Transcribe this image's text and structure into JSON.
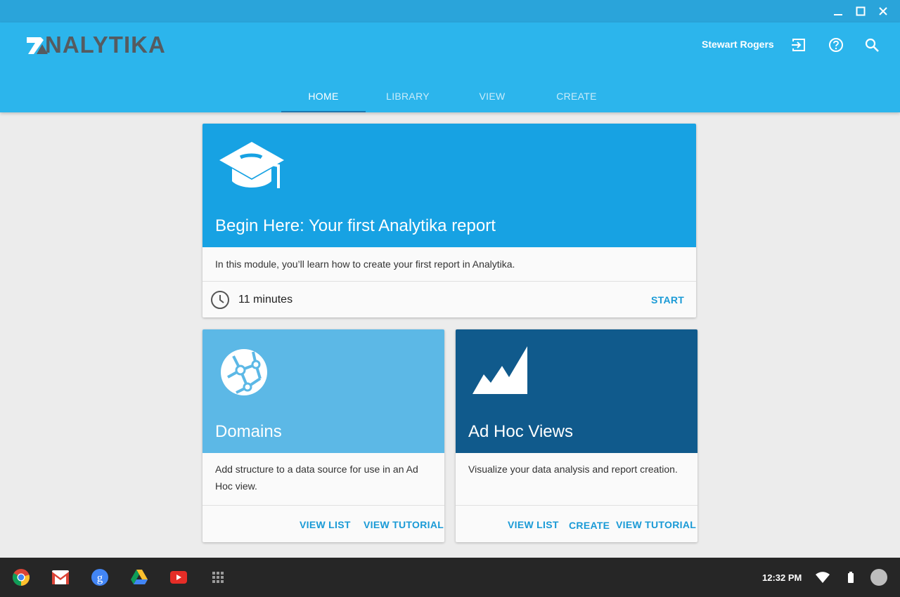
{
  "app": {
    "logo_text": "NALYTIKA",
    "user_name": "Stewart Rogers"
  },
  "tabs": [
    {
      "label": "HOME"
    },
    {
      "label": "LIBRARY"
    },
    {
      "label": "VIEW"
    },
    {
      "label": "CREATE"
    }
  ],
  "featured": {
    "title": "Begin Here: Your first Analytika report",
    "description": "In this module, you’ll learn how to create your first report in Analytika.",
    "duration": "11 minutes",
    "start_label": "START",
    "icon": "graduation-cap-icon",
    "hero_color": "#17a2e3"
  },
  "domains": {
    "title": "Domains",
    "description": "Add structure to a data source for use in an Ad Hoc view.",
    "view_list_label": "VIEW LIST",
    "view_tutorial_label": "VIEW TUTORIAL",
    "icon": "globe-network-icon",
    "hero_color": "#5cb8e6"
  },
  "adhoc": {
    "title": "Ad Hoc Views",
    "description": "Visualize your data analysis and report creation.",
    "view_list_label": "VIEW LIST",
    "create_label": "CREATE",
    "view_tutorial_label": "VIEW TUTORIAL",
    "icon": "area-chart-icon",
    "hero_color": "#105a8c"
  },
  "shelf": {
    "apps": [
      "chrome-icon",
      "gmail-icon",
      "google-search-icon",
      "google-drive-icon",
      "youtube-icon",
      "app-launcher-icon"
    ],
    "clock": "12:32 PM"
  },
  "colors": {
    "titlebar": "#2aa4da",
    "appbar": "#2cb5ec",
    "accent": "#1a9ad6"
  }
}
